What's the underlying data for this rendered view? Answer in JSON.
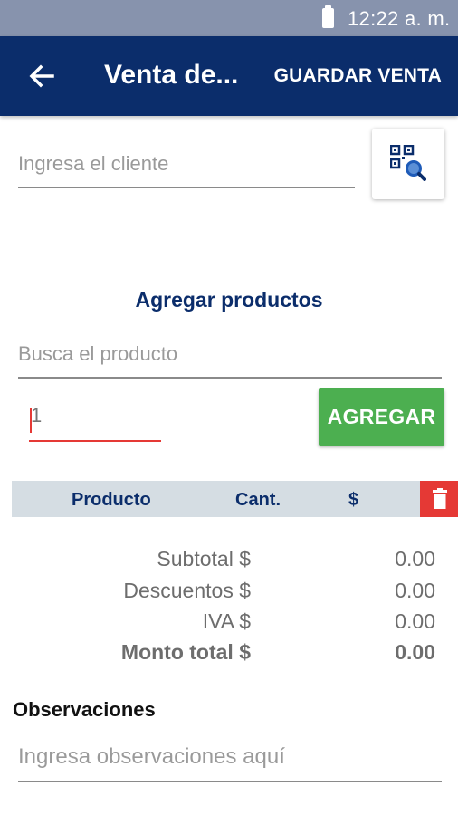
{
  "status_bar": {
    "time": "12:22 a. m."
  },
  "app_bar": {
    "title": "Venta de...",
    "save_label": "GUARDAR VENTA"
  },
  "client": {
    "placeholder": "Ingresa el cliente"
  },
  "products": {
    "section_title": "Agregar productos",
    "search_placeholder": "Busca el producto",
    "quantity_placeholder": "1",
    "add_label": "AGREGAR"
  },
  "table": {
    "headers": [
      "Producto",
      "Cant.",
      "$"
    ]
  },
  "totals": {
    "rows": [
      {
        "label": "Subtotal $",
        "value": "0.00"
      },
      {
        "label": "Descuentos $",
        "value": "0.00"
      },
      {
        "label": "IVA $",
        "value": "0.00"
      },
      {
        "label": "Monto total $",
        "value": "0.00"
      }
    ]
  },
  "observations": {
    "title": "Observaciones",
    "placeholder": "Ingresa observaciones aquí"
  },
  "colors": {
    "app_bar": "#0b2d6b",
    "status_bar": "#8793ad",
    "accent_green": "#4caf50",
    "accent_red": "#e53935",
    "table_header_bg": "#d5dde3"
  }
}
